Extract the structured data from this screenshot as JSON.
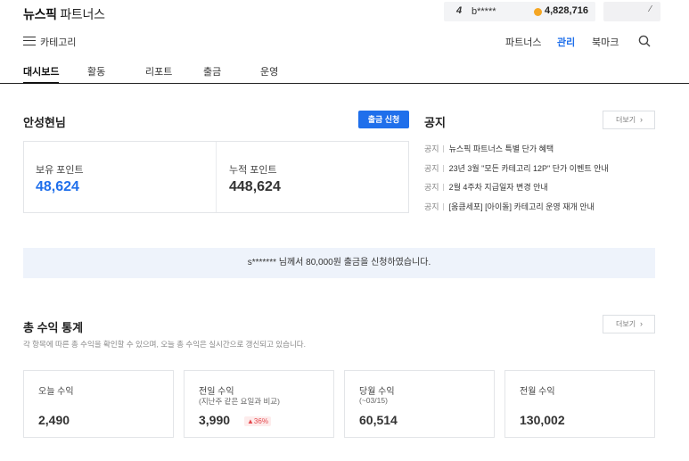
{
  "brand": {
    "bold": "뉴스픽",
    "rest": "파트너스"
  },
  "user": {
    "level": "4",
    "name": "b*****",
    "coins": "4,828,716"
  },
  "nav": {
    "category_label": "카테고리",
    "links": [
      "파트너스",
      "관리",
      "북마크"
    ],
    "active_link": "관리"
  },
  "tabs": [
    "대시보드",
    "활동",
    "리포트",
    "출금",
    "운영"
  ],
  "active_tab": "대시보드",
  "greeting": "안성현님",
  "withdraw_button": "출금 신청",
  "points": {
    "held_label": "보유 포인트",
    "held_value": "48,624",
    "total_label": "누적 포인트",
    "total_value": "448,624"
  },
  "notice": {
    "title": "공지",
    "more_label": "더보기",
    "items": [
      {
        "tag": "공지",
        "text": "뉴스픽 파트너스 특별 단가 혜택"
      },
      {
        "tag": "공지",
        "text": "23년 3월 \"모든 카테고리 12P\" 단가 이벤트 안내"
      },
      {
        "tag": "공지",
        "text": "2월 4주차 지급일자 변경 안내"
      },
      {
        "tag": "공지",
        "text": "[움큼세포] [아이돌] 카테고리 운영 재개 안내"
      }
    ]
  },
  "banner": "s******* 님께서 80,000원 출금을 신청하였습니다.",
  "stats": {
    "title": "총 수익 통계",
    "description": "각 항목에 따른 총 수익을 확인할 수 있으며, 오늘 총 수익은 실시간으로 갱신되고 있습니다.",
    "more_label": "더보기",
    "cards": [
      {
        "label": "오늘 수익",
        "sub": "",
        "value": "2,490",
        "change": ""
      },
      {
        "label": "전일 수익",
        "sub": "(지난주 같은 요일과 비교)",
        "value": "3,990",
        "change": "▲36%"
      },
      {
        "label": "당월 수익",
        "sub": "(~03/15)",
        "value": "60,514",
        "change": ""
      },
      {
        "label": "전월 수익",
        "sub": "",
        "value": "130,002",
        "change": ""
      }
    ]
  },
  "colors": {
    "accent": "#1f6feb",
    "coin": "#f5a623",
    "up": "#e5484d",
    "banner_bg": "#eef3fb"
  }
}
